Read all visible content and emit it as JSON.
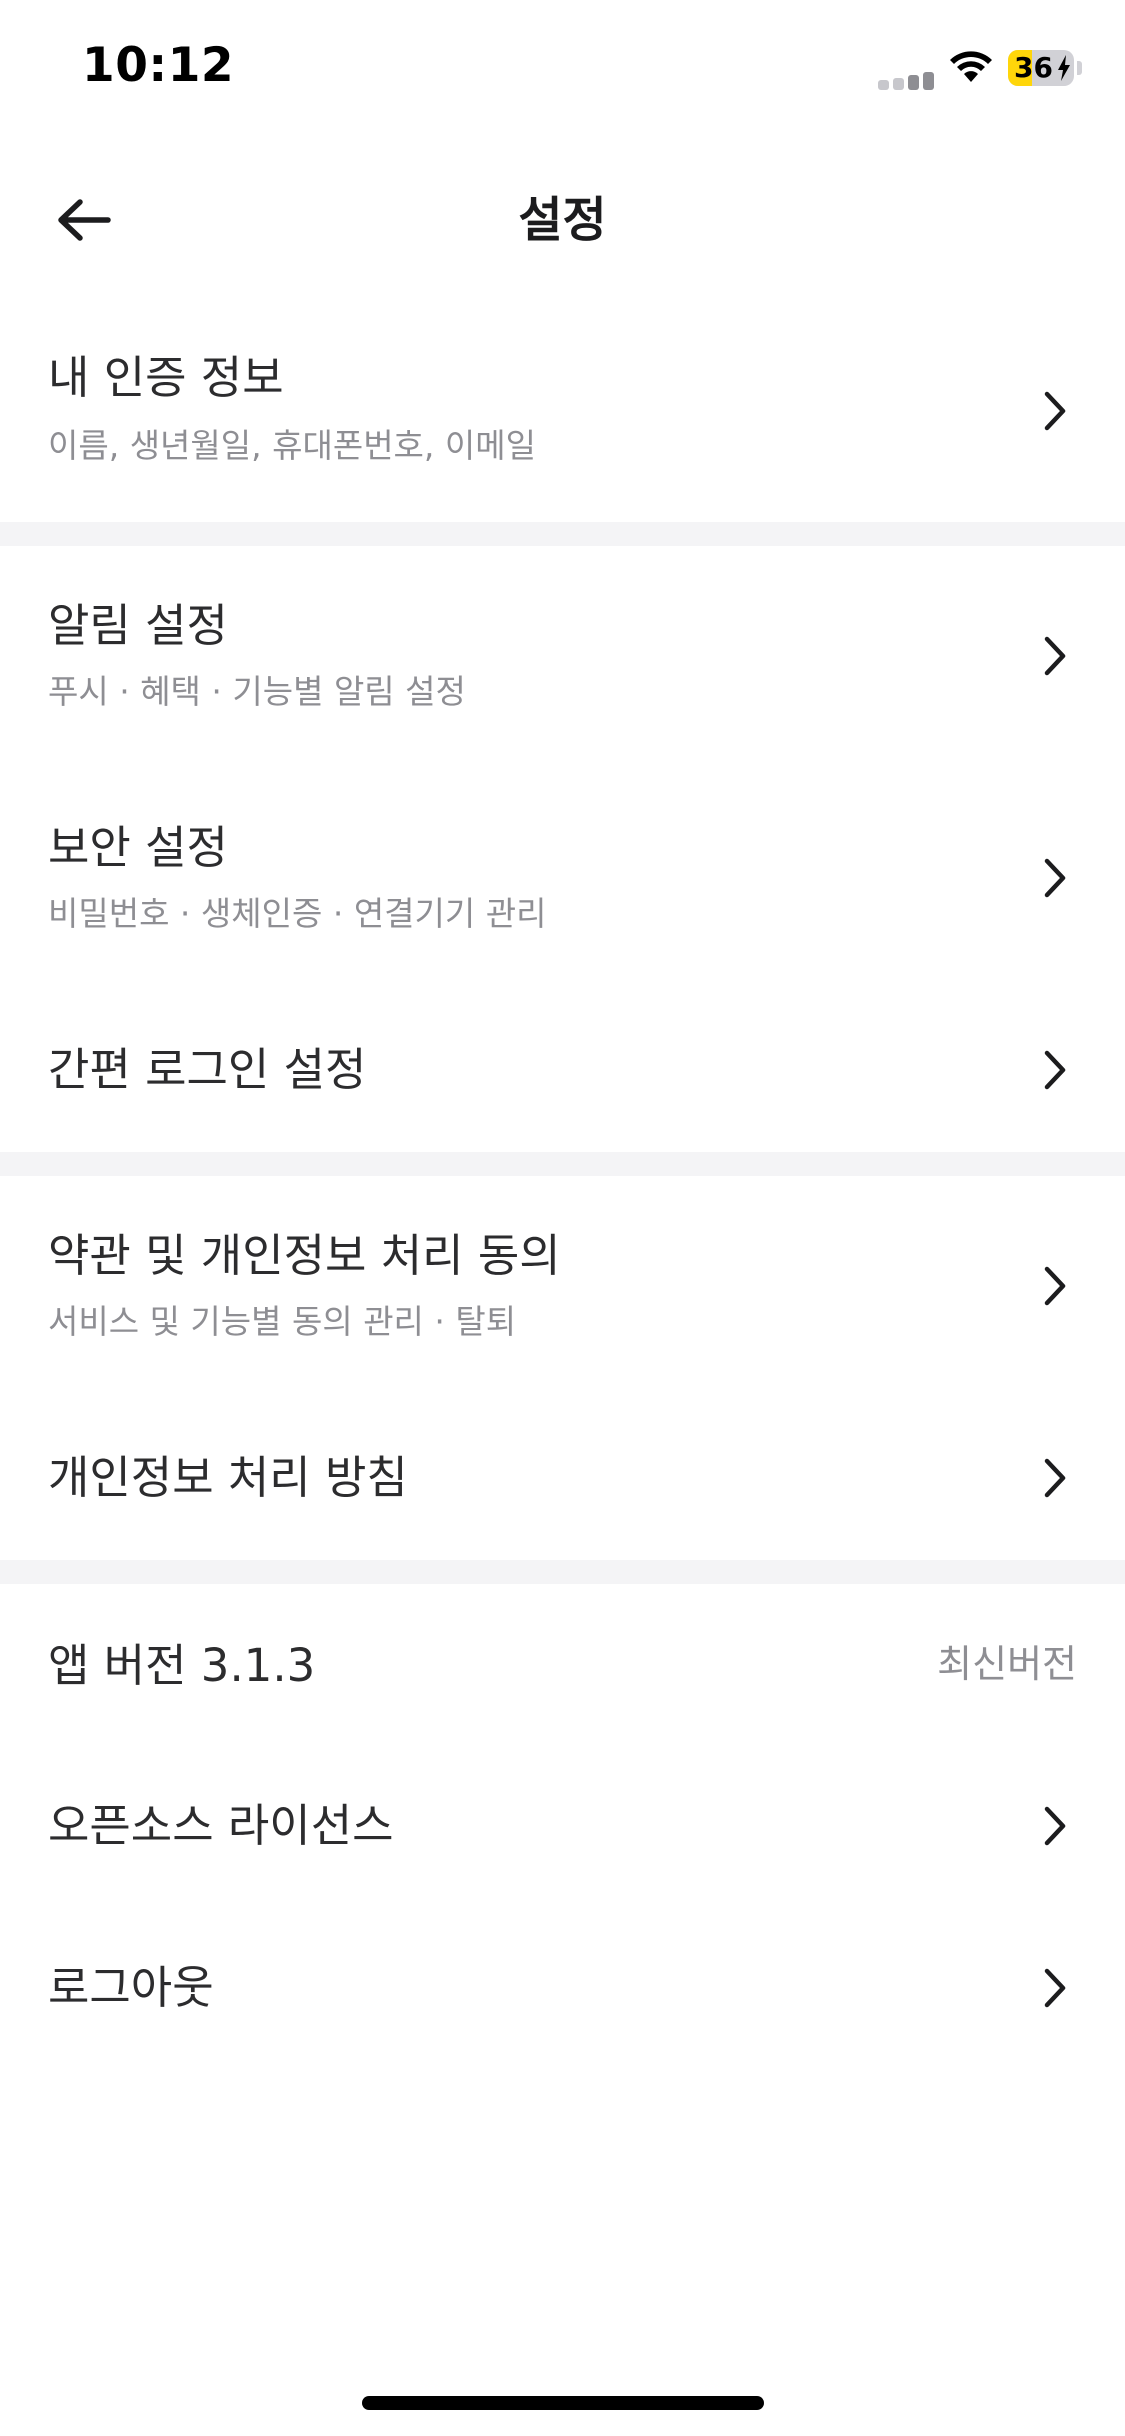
{
  "status_bar": {
    "time": "10:12",
    "battery_level": "36",
    "battery_percent": 36,
    "battery_color": "#ffd60a",
    "signal_bars_active": 2,
    "icons": [
      "signal-icon",
      "wifi-icon",
      "battery-icon",
      "charging-bolt-icon"
    ]
  },
  "nav": {
    "title": "설정",
    "back_icon": "back-arrow-icon"
  },
  "sections": [
    {
      "items": [
        {
          "title": "내 인증 정보",
          "subtitle": "이름, 생년월일, 휴대폰번호, 이메일",
          "icon": "chevron-right-icon"
        }
      ]
    },
    {
      "items": [
        {
          "title": "알림 설정",
          "subtitle": "푸시 · 혜택 · 기능별 알림 설정",
          "icon": "chevron-right-icon"
        },
        {
          "title": "보안 설정",
          "subtitle": "비밀번호 · 생체인증 · 연결기기 관리",
          "icon": "chevron-right-icon"
        },
        {
          "title": "간편 로그인 설정",
          "icon": "chevron-right-icon"
        }
      ]
    },
    {
      "items": [
        {
          "title": "약관 및 개인정보 처리 동의",
          "subtitle": "서비스 및 기능별 동의 관리 · 탈퇴",
          "icon": "chevron-right-icon"
        },
        {
          "title": "개인정보 처리 방침",
          "icon": "chevron-right-icon"
        }
      ]
    },
    {
      "items": [
        {
          "title": "앱 버전 3.1.3",
          "value": "최신버전"
        },
        {
          "title": "오픈소스 라이선스",
          "icon": "chevron-right-icon"
        },
        {
          "title": "로그아웃",
          "icon": "chevron-right-icon"
        }
      ]
    }
  ],
  "colors": {
    "section_gap": "#f4f4f6",
    "title_text": "#2c2c2e",
    "secondary_text": "#8e8e93"
  }
}
